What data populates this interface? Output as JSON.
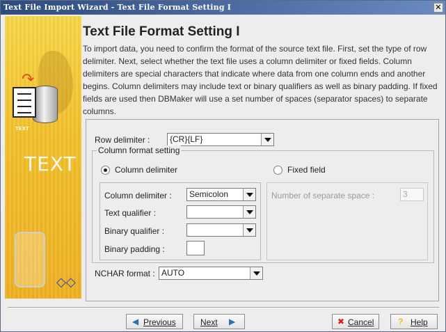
{
  "window": {
    "title": "Text File Import Wizard - Text File Format Setting I"
  },
  "sidebar": {
    "text_watermark": "TEXT",
    "doc_label": "TEXT"
  },
  "header": {
    "title": "Text File Format Setting I",
    "description": "To import data, you need to confirm the format of the source text file. First, set the type of row delimiter. Next, select whether the text file uses a column delimiter or fixed fields. Column delimiters are special characters that indicate where data from one column ends and another begins. Column delimiters may include text or binary qualifiers as well as binary padding.  If fixed fields are used then DBMaker will use a set number of spaces (separator spaces) to separate columns."
  },
  "row_delimiter": {
    "label": "Row delimiter :",
    "value": "{CR}{LF}"
  },
  "column_format": {
    "title": "Column format setting",
    "column_delimiter_option": {
      "label": "Column delimiter",
      "selected": true
    },
    "fixed_field_option": {
      "label": "Fixed field",
      "selected": false
    },
    "column_delimiter": {
      "label": "Column delimiter :",
      "value": "Semicolon"
    },
    "text_qualifier": {
      "label": "Text qualifier :",
      "value": ""
    },
    "binary_qualifier": {
      "label": "Binary qualifier :",
      "value": ""
    },
    "binary_padding": {
      "label": "Binary padding :",
      "value": ""
    },
    "separate_space": {
      "label": "Number of separate space :",
      "value": "3"
    }
  },
  "nchar": {
    "label": "NCHAR format :",
    "value": "AUTO"
  },
  "buttons": {
    "previous": "Previous",
    "next": "Next",
    "cancel": "Cancel",
    "help": "Help"
  },
  "colors": {
    "titlebar": "#2e4b7c",
    "sidebar": "#f3c12c",
    "cancel_icon": "#d32020",
    "help_icon": "#e8c000",
    "nav_arrow": "#2e6fb7"
  }
}
